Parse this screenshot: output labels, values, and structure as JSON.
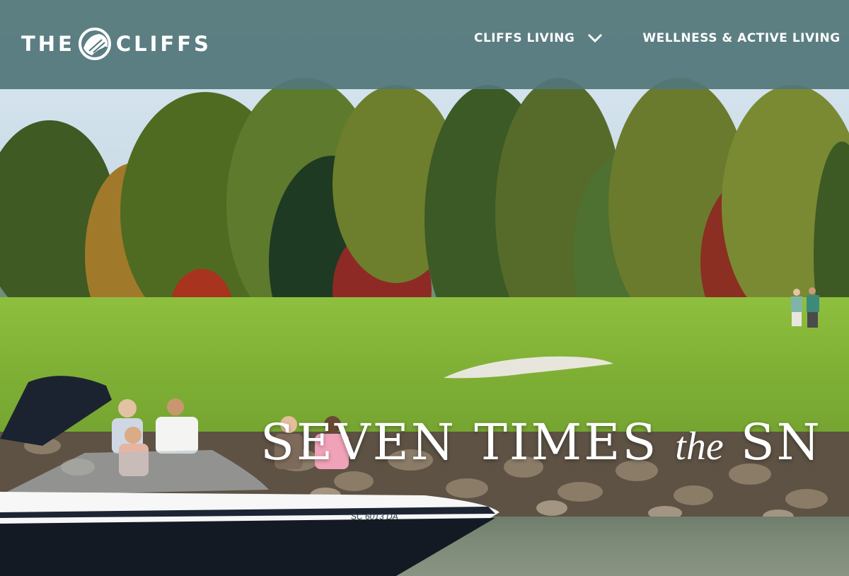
{
  "header": {
    "logo": {
      "text_left": "THE",
      "text_right": "CLIFFS",
      "mark_icon": "cliffs-emblem-icon"
    },
    "nav": [
      {
        "label": "CLIFFS LIVING",
        "icon": "chevron-down-icon"
      },
      {
        "label": "WELLNESS & ACTIVE LIVING",
        "icon": "chevron-down-icon"
      }
    ]
  },
  "hero": {
    "headline_part1": "SEVEN TIMES",
    "headline_italic": "the",
    "headline_part2": "SN",
    "boat_registration": "SC 6013 DA"
  },
  "colors": {
    "header_bg": "#52767a",
    "text": "#ffffff"
  }
}
